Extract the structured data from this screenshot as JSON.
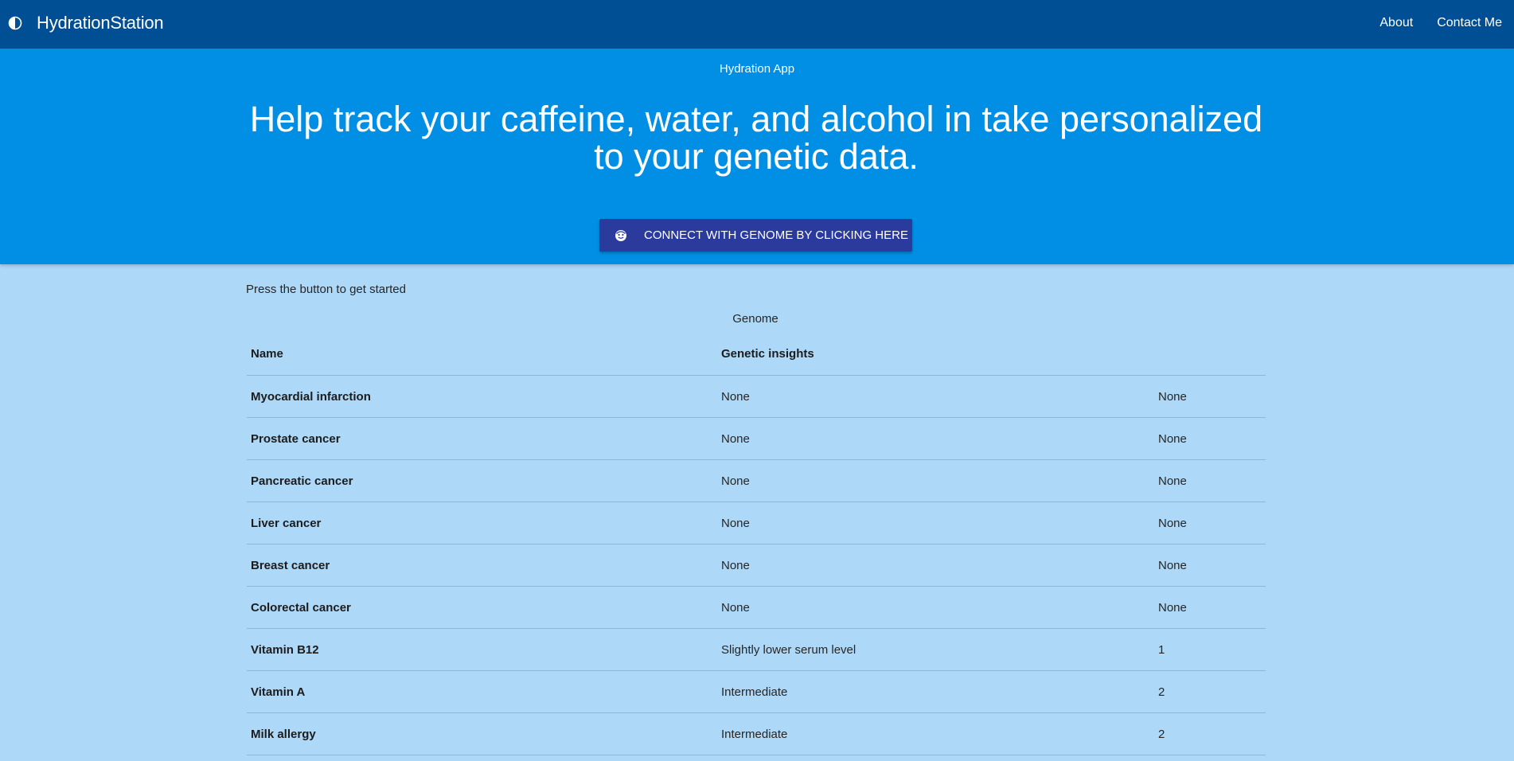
{
  "navbar": {
    "brand": "HydrationStation",
    "links": [
      "About",
      "Contact Me"
    ]
  },
  "hero": {
    "subtitle": "Hydration App",
    "title": "Help track your caffeine, water, and alcohol in take personalized to your genetic data.",
    "cta_label": "CONNECT WITH GENOME BY CLICKING HERE"
  },
  "intro": "Press the button to get started",
  "table": {
    "caption": "Genome",
    "headers": [
      "Name",
      "Genetic insights"
    ],
    "rows": [
      {
        "name": "Myocardial infarction",
        "insight": "None",
        "score": "None"
      },
      {
        "name": "Prostate cancer",
        "insight": "None",
        "score": "None"
      },
      {
        "name": "Pancreatic cancer",
        "insight": "None",
        "score": "None"
      },
      {
        "name": "Liver cancer",
        "insight": "None",
        "score": "None"
      },
      {
        "name": "Breast cancer",
        "insight": "None",
        "score": "None"
      },
      {
        "name": "Colorectal cancer",
        "insight": "None",
        "score": "None"
      },
      {
        "name": "Vitamin B12",
        "insight": "Slightly lower serum level",
        "score": "1"
      },
      {
        "name": "Vitamin A",
        "insight": "Intermediate",
        "score": "2"
      },
      {
        "name": "Milk allergy",
        "insight": "Intermediate",
        "score": "2"
      }
    ]
  },
  "colors": {
    "navbar": "#004e94",
    "hero": "#008fe4",
    "page_background": "#aed8f8",
    "cta_button": "#2b3a9d"
  },
  "icons": {
    "brand": "contrast-drop-icon",
    "cta": "smiley-face-icon"
  }
}
